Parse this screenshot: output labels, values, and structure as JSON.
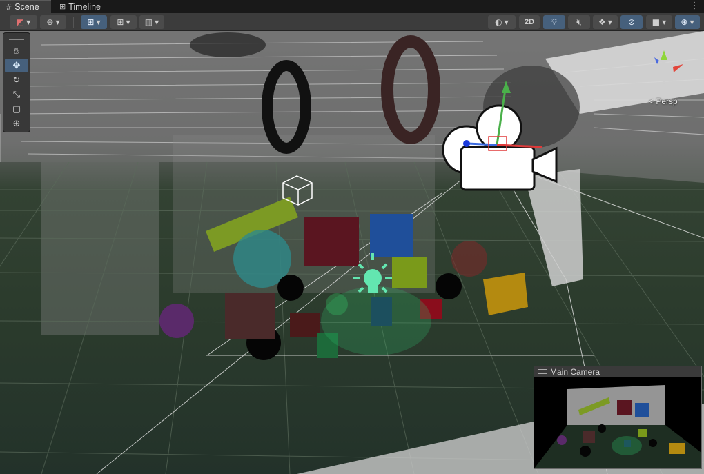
{
  "tabs": [
    {
      "label": "Scene",
      "icon": "grid-icon",
      "active": true
    },
    {
      "label": "Timeline",
      "icon": "timeline-icon",
      "active": false
    }
  ],
  "toolbar": {
    "mode_2d_label": "2D",
    "active_color": "#46607c"
  },
  "tools": [
    "hand-tool",
    "move-tool",
    "rotate-tool",
    "scale-tool",
    "rect-tool",
    "transform-tool"
  ],
  "scene": {
    "projection_label": "< Persp",
    "floor_color": "#2c3c2d",
    "light_icon_color": "#63e6b0"
  },
  "preview": {
    "title": "Main Camera"
  }
}
